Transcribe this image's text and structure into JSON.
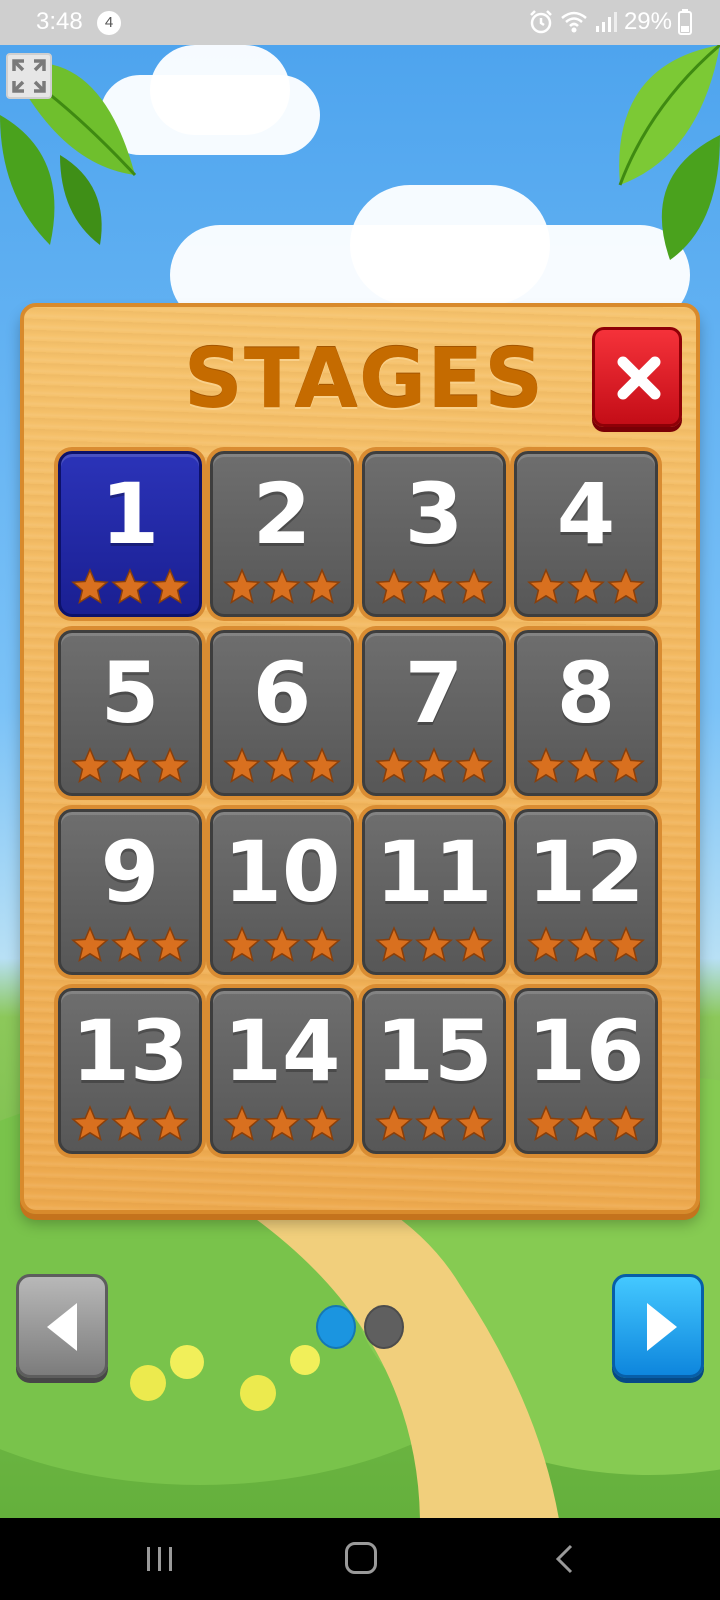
{
  "status_bar": {
    "time": "3:48",
    "notification_count": "4",
    "battery": "29%",
    "icons": [
      "alarm-icon",
      "wifi-icon",
      "signal-icon",
      "battery-icon"
    ]
  },
  "panel": {
    "title": "STAGES",
    "close_icon": "close-icon"
  },
  "stages": [
    {
      "number": "1",
      "stars": 3,
      "selected": true
    },
    {
      "number": "2",
      "stars": 3,
      "selected": false
    },
    {
      "number": "3",
      "stars": 3,
      "selected": false
    },
    {
      "number": "4",
      "stars": 3,
      "selected": false
    },
    {
      "number": "5",
      "stars": 3,
      "selected": false
    },
    {
      "number": "6",
      "stars": 3,
      "selected": false
    },
    {
      "number": "7",
      "stars": 3,
      "selected": false
    },
    {
      "number": "8",
      "stars": 3,
      "selected": false
    },
    {
      "number": "9",
      "stars": 3,
      "selected": false
    },
    {
      "number": "10",
      "stars": 3,
      "selected": false
    },
    {
      "number": "11",
      "stars": 3,
      "selected": false
    },
    {
      "number": "12",
      "stars": 3,
      "selected": false
    },
    {
      "number": "13",
      "stars": 3,
      "selected": false
    },
    {
      "number": "14",
      "stars": 3,
      "selected": false
    },
    {
      "number": "15",
      "stars": 3,
      "selected": false
    },
    {
      "number": "16",
      "stars": 3,
      "selected": false
    }
  ],
  "pagination": {
    "current_page": 1,
    "total_pages": 2,
    "active_color": "#1b95e0",
    "inactive_color": "#5f5f5f"
  },
  "colors": {
    "selected_tile": "#1f25a0",
    "tile": "#5f5f5f",
    "star": "#d9701f",
    "title": "#c56b00"
  },
  "controls": {
    "prev_icon": "left-arrow-icon",
    "next_icon": "right-arrow-icon",
    "fullscreen_icon": "fullscreen-icon"
  },
  "nav_bar": {
    "icons": [
      "recent-apps-icon",
      "home-icon",
      "back-icon"
    ]
  }
}
